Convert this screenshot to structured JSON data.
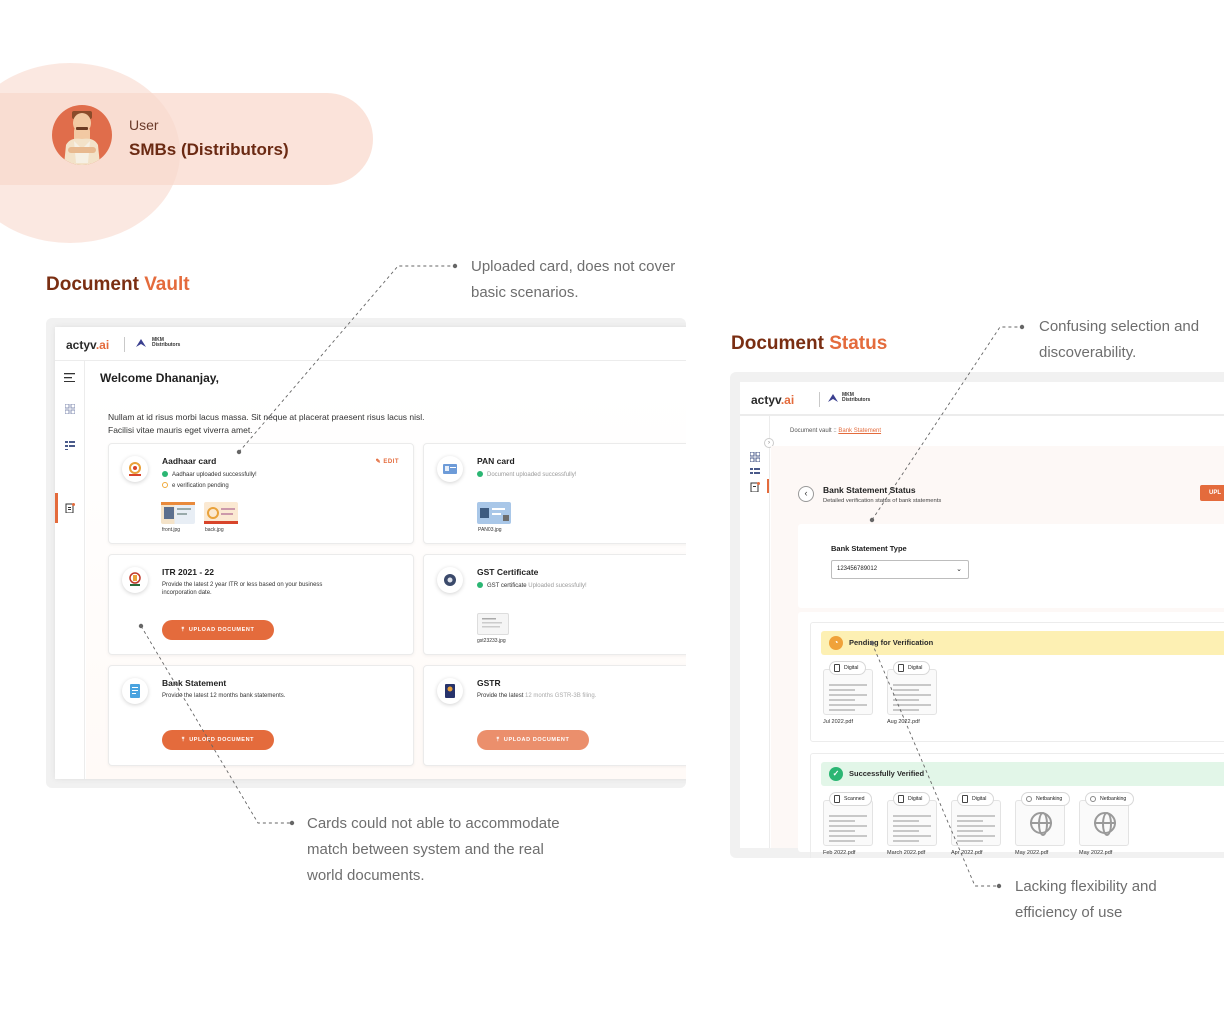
{
  "user": {
    "role": "User",
    "name": "SMBs (Distributors)"
  },
  "sections": {
    "vault": {
      "title_a": "Document",
      "title_b": "Vault"
    },
    "status": {
      "title_a": "Document",
      "title_b": "Status"
    }
  },
  "annotations": {
    "uploaded_card": [
      "Uploaded card, does not cover",
      "basic scenarios."
    ],
    "cards_match": [
      "Cards could not able to accommodate",
      "match between system and the real",
      "world documents."
    ],
    "confusing": [
      "Confusing selection and",
      "discoverability."
    ],
    "flexibility": [
      "Lacking flexibility and",
      "efficiency of use"
    ]
  },
  "app": {
    "logo_main": "actyv",
    "logo_dot": ".ai",
    "brand_line1": "MKM",
    "brand_line2": "Distributors"
  },
  "vault": {
    "welcome": "Welcome Dhananjay,",
    "intro_line1": "Nullam at id risus morbi lacus massa. Sit neque at placerat praesent risus lacus nisl.",
    "intro_line2": "Facilisi vitae mauris eget viverra amet.",
    "edit_label": "EDIT",
    "upload_label": "UPLOAD DOCUMENT",
    "upload_label_typo": "UPLOFD DOCUMENT",
    "cards": {
      "aadhaar": {
        "title": "Aadhaar card",
        "status1": "Aadhaar uploaded successfully!",
        "status2": "e verification pending",
        "file1": "front.jpg",
        "file2": "back.jpg"
      },
      "pan": {
        "title": "PAN card",
        "status1": "Document uploaded successfully!",
        "file1": "PAN03.jpg"
      },
      "itr": {
        "title": "ITR 2021 - 22",
        "desc": "Provide the latest 2 year ITR or less based on your business incorporation date."
      },
      "gst": {
        "title": "GST  Certificate",
        "status_a": "GST certificate",
        "status_b": " Uploaded sucessfully!",
        "file1": "gst23233.jpg"
      },
      "bank": {
        "title": "Bank Statement",
        "desc": "Provide the latest 12 months bank statements."
      },
      "gstr": {
        "title": "GSTR",
        "desc_a": "Provide the latest ",
        "desc_b": "12 months GSTR-3B filing."
      }
    }
  },
  "status_page": {
    "crumb_root": "Document vault",
    "crumb_sep": " :: ",
    "crumb_current": "Bank Statement",
    "title": "Bank Statement Status",
    "subtitle": "Detailed verification status of bank statements",
    "upload_tab": "UPL",
    "type_label": "Bank Statement Type",
    "type_value": "123456789012",
    "pending_title": "Pending for Verification",
    "verified_title": "Successfully Verified",
    "pending_docs": [
      {
        "tag": "Digital",
        "file": "Jul 2022.pdf"
      },
      {
        "tag": "Digital",
        "file": "Aug 2022.pdf"
      }
    ],
    "verified_docs": [
      {
        "tag": "Scanned",
        "file": "Feb 2022.pdf"
      },
      {
        "tag": "Digital",
        "file": "March 2022.pdf"
      },
      {
        "tag": "Digital",
        "file": "Apr 2022.pdf"
      },
      {
        "tag": "Netbanking",
        "file": "May 2022.pdf"
      },
      {
        "tag": "Netbanking",
        "file": "May 2022.pdf"
      }
    ]
  },
  "colors": {
    "accent": "#e46b3c",
    "brand_dark": "#7a2e12",
    "pending_bg": "#fdf0b3",
    "verified_bg": "#e2f6e8"
  }
}
